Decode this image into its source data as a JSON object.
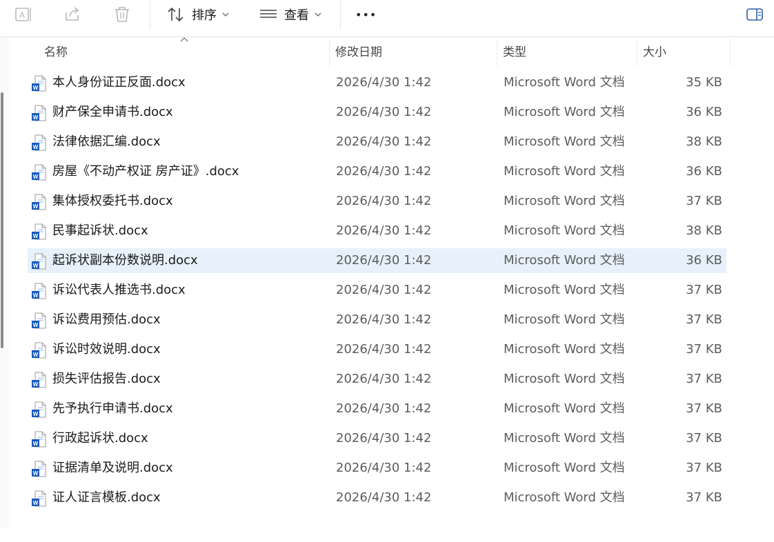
{
  "toolbar": {
    "sort_label": "排序",
    "view_label": "查看",
    "more_label": "•••"
  },
  "columns": {
    "name": "名称",
    "date": "修改日期",
    "type": "类型",
    "size": "大小"
  },
  "files": [
    {
      "name": "本人身份证正反面.docx",
      "date": "2026/4/30 1:42",
      "type": "Microsoft Word 文档",
      "size": "35 KB"
    },
    {
      "name": "财产保全申请书.docx",
      "date": "2026/4/30 1:42",
      "type": "Microsoft Word 文档",
      "size": "36 KB"
    },
    {
      "name": "法律依据汇编.docx",
      "date": "2026/4/30 1:42",
      "type": "Microsoft Word 文档",
      "size": "38 KB"
    },
    {
      "name": "房屋《不动产权证 房产证》.docx",
      "date": "2026/4/30 1:42",
      "type": "Microsoft Word 文档",
      "size": "36 KB"
    },
    {
      "name": "集体授权委托书.docx",
      "date": "2026/4/30 1:42",
      "type": "Microsoft Word 文档",
      "size": "37 KB"
    },
    {
      "name": "民事起诉状.docx",
      "date": "2026/4/30 1:42",
      "type": "Microsoft Word 文档",
      "size": "38 KB"
    },
    {
      "name": "起诉状副本份数说明.docx",
      "date": "2026/4/30 1:42",
      "type": "Microsoft Word 文档",
      "size": "36 KB"
    },
    {
      "name": "诉讼代表人推选书.docx",
      "date": "2026/4/30 1:42",
      "type": "Microsoft Word 文档",
      "size": "37 KB"
    },
    {
      "name": "诉讼费用预估.docx",
      "date": "2026/4/30 1:42",
      "type": "Microsoft Word 文档",
      "size": "37 KB"
    },
    {
      "name": "诉讼时效说明.docx",
      "date": "2026/4/30 1:42",
      "type": "Microsoft Word 文档",
      "size": "37 KB"
    },
    {
      "name": "损失评估报告.docx",
      "date": "2026/4/30 1:42",
      "type": "Microsoft Word 文档",
      "size": "37 KB"
    },
    {
      "name": "先予执行申请书.docx",
      "date": "2026/4/30 1:42",
      "type": "Microsoft Word 文档",
      "size": "37 KB"
    },
    {
      "name": "行政起诉状.docx",
      "date": "2026/4/30 1:42",
      "type": "Microsoft Word 文档",
      "size": "37 KB"
    },
    {
      "name": "证据清单及说明.docx",
      "date": "2026/4/30 1:42",
      "type": "Microsoft Word 文档",
      "size": "37 KB"
    },
    {
      "name": "证人证言模板.docx",
      "date": "2026/4/30 1:42",
      "type": "Microsoft Word 文档",
      "size": "37 KB"
    }
  ],
  "selected_index": 6,
  "colors": {
    "selected_row": "#e6f1fb",
    "word_blue": "#185abd",
    "icon_gray": "#b8b8b8"
  }
}
